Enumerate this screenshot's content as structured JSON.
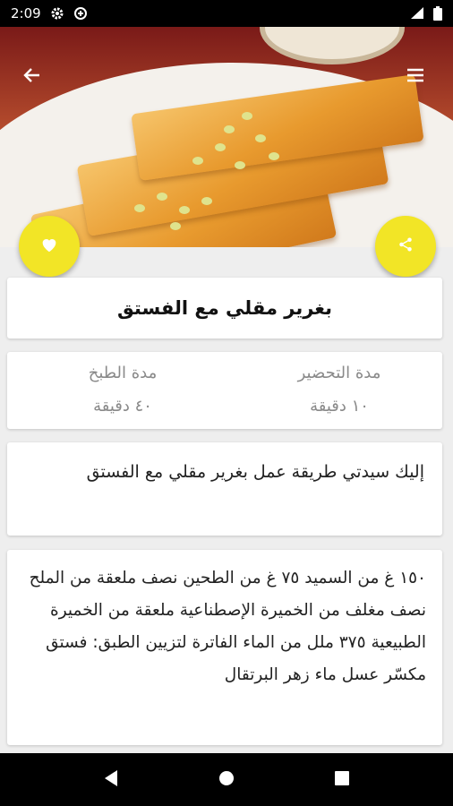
{
  "status_bar": {
    "time": "2:09"
  },
  "recipe": {
    "title": "بغرير مقلي مع الفستق",
    "prep_label": "مدة التحضير",
    "prep_value": "١٠ دقيقة",
    "cook_label": "مدة الطبخ",
    "cook_value": "٤٠ دقيقة",
    "intro": "إليك سيدتي طريقة عمل بغرير مقلي مع الفستق",
    "ingredients": "١٥٠ غ من السميد ٧٥ غ من الطحين نصف ملعقة من الملح نصف مغلف من الخميرة الإصطناعية ملعقة من الخميرة الطبيعية ٣٧٥ ملل من الماء الفاترة لتزيين الطبق: فستق مكسّر عسل ماء زهر البرتقال"
  },
  "icons": {
    "back": "arrow-left-icon",
    "menu": "hamburger-menu-icon",
    "favorite": "heart-icon",
    "share": "share-icon"
  },
  "colors": {
    "accent": "#f2e526",
    "status_bar": "#000000",
    "background": "#eeeeee"
  }
}
